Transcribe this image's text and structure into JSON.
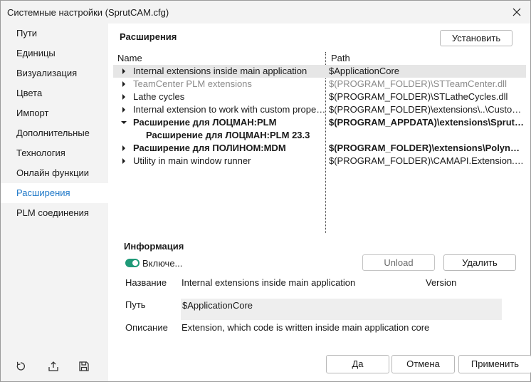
{
  "window": {
    "title": "Системные настройки (SprutCAM.cfg)"
  },
  "sidebar": {
    "items": [
      {
        "label": "Пути"
      },
      {
        "label": "Единицы"
      },
      {
        "label": "Визуализация"
      },
      {
        "label": "Цвета"
      },
      {
        "label": "Импорт"
      },
      {
        "label": "Дополнительные"
      },
      {
        "label": "Технология"
      },
      {
        "label": "Онлайн функции"
      },
      {
        "label": "Расширения"
      },
      {
        "label": "PLM соединения"
      }
    ],
    "active": "Расширения",
    "tools": [
      "reset-icon",
      "export-icon",
      "save-icon"
    ]
  },
  "extensions": {
    "title": "Расширения",
    "install_label": "Установить",
    "columns": {
      "name": "Name",
      "path": "Path"
    },
    "rows": [
      {
        "name": "Internal extensions inside main application",
        "path": "$ApplicationCore",
        "state": "collapsed",
        "selected": true
      },
      {
        "name": "TeamCenter PLM extensions",
        "path": "$(PROGRAM_FOLDER)\\STTeamCenter.dll",
        "state": "collapsed",
        "dim": true
      },
      {
        "name": "Lathe cycles",
        "path": "$(PROGRAM_FOLDER)\\STLatheCycles.dll",
        "state": "collapsed"
      },
      {
        "name": "Internal extension to work with custom properties",
        "path": "$(PROGRAM_FOLDER)\\extensions\\..\\CustomProperties.dll",
        "state": "collapsed"
      },
      {
        "name": "Расширение для ЛОЦМАН:PLM",
        "path": "$(PROGRAM_APPDATA)\\extensions\\SprutTechLocman.dll",
        "state": "expanded",
        "bold": true
      },
      {
        "name": "Расширение для ЛОЦМАН:PLM 23.3",
        "path": "",
        "child": true,
        "bold": true
      },
      {
        "name": "Расширение для ПОЛИНОМ:MDM",
        "path": "$(PROGRAM_FOLDER)\\extensions\\Polynom.dll",
        "state": "collapsed",
        "bold": true
      },
      {
        "name": "Utility in main window runner",
        "path": "$(PROGRAM_FOLDER)\\CAMAPI.Extension.Utility.dll",
        "state": "collapsed"
      }
    ]
  },
  "info": {
    "title": "Информация",
    "enabled_label": "Включе...",
    "enabled": true,
    "unload_label": "Unload",
    "delete_label": "Удалить",
    "name_label": "Название",
    "name_value": "Internal extensions inside main application",
    "version_label": "Version",
    "path_label": "Путь",
    "path_value": "$ApplicationCore",
    "desc_label": "Описание",
    "desc_value": "Extension, which code is written inside main application core"
  },
  "footer": {
    "ok_label": "Да",
    "cancel_label": "Отмена",
    "apply_label": "Применить"
  },
  "colors": {
    "accent": "#1e78c8",
    "toggle_on": "#1f9a78",
    "selected_row": "#e6e6e6"
  }
}
